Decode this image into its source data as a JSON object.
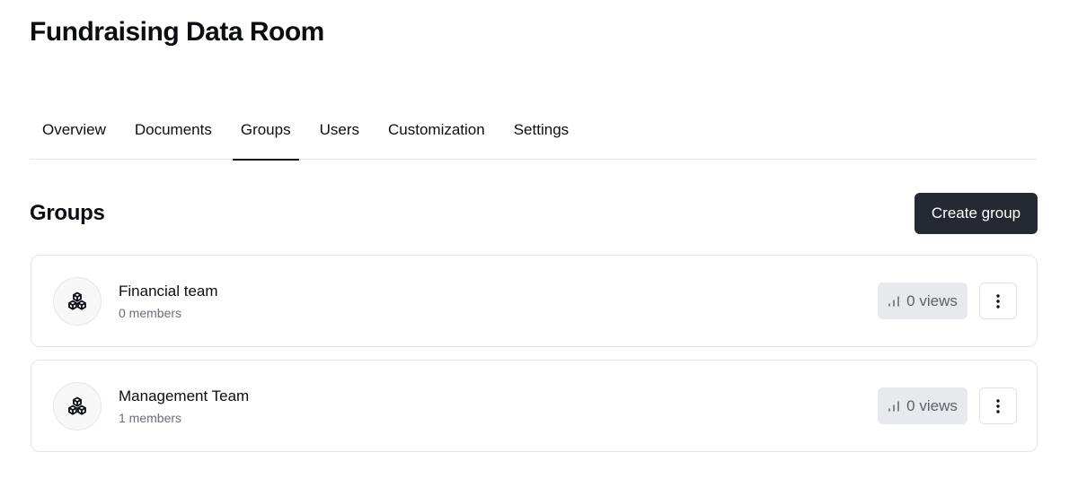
{
  "page": {
    "title": "Fundraising Data Room"
  },
  "tabs": [
    {
      "label": "Overview",
      "active": false
    },
    {
      "label": "Documents",
      "active": false
    },
    {
      "label": "Groups",
      "active": true
    },
    {
      "label": "Users",
      "active": false
    },
    {
      "label": "Customization",
      "active": false
    },
    {
      "label": "Settings",
      "active": false
    }
  ],
  "groups_section": {
    "title": "Groups",
    "create_button_label": "Create group"
  },
  "groups": [
    {
      "name": "Financial team",
      "members": "0 members",
      "views": "0 views",
      "icon": "boxes-icon"
    },
    {
      "name": "Management Team",
      "members": "1 members",
      "views": "0 views",
      "icon": "boxes-icon"
    }
  ],
  "icons": {
    "views": "bar-chart-icon",
    "menu": "more-vertical-icon"
  },
  "colors": {
    "primary_button": "#252932",
    "badge_bg": "#e8e9ec",
    "border": "#e4e5e9",
    "active_tab_underline": "#111318"
  }
}
